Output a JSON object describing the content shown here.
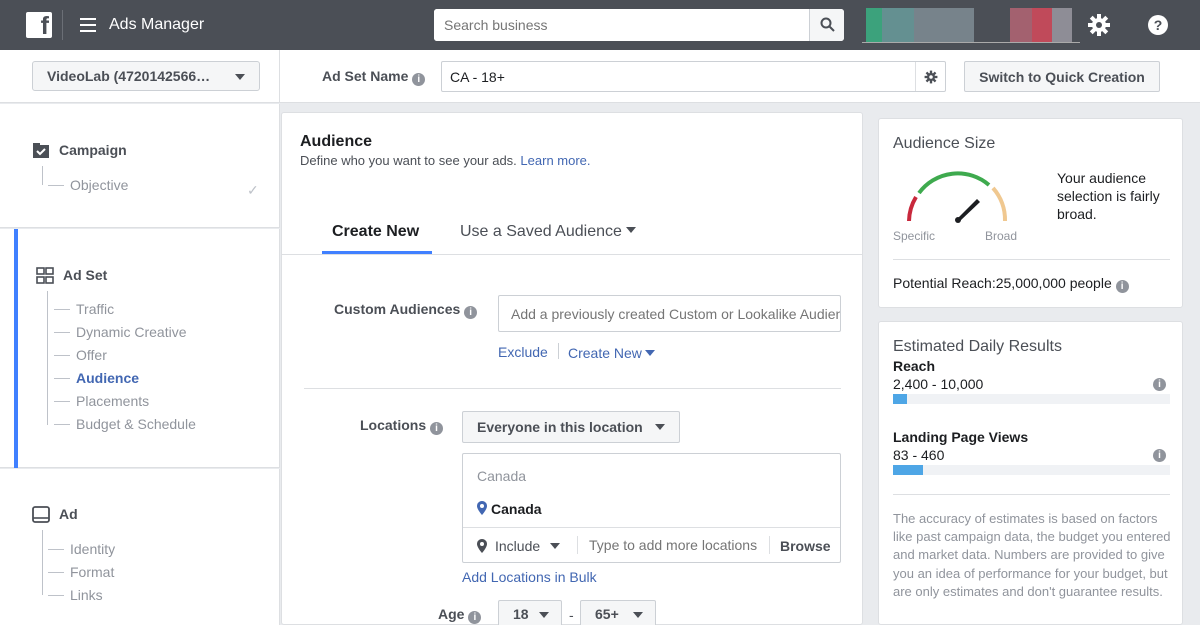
{
  "header": {
    "logo": "f",
    "app_title": "Ads Manager",
    "search_placeholder": "Search business",
    "icons": [
      "hamburger-icon",
      "search-icon",
      "gear-icon",
      "help-icon"
    ]
  },
  "account": {
    "selector_label": "VideoLab (4720142566…"
  },
  "adset_bar": {
    "label": "Ad Set Name",
    "value": "CA - 18+",
    "quick_creation_label": "Switch to Quick Creation"
  },
  "nav": {
    "campaign": {
      "label": "Campaign",
      "items": [
        {
          "label": "Objective"
        }
      ]
    },
    "adset": {
      "label": "Ad Set",
      "items": [
        {
          "label": "Traffic"
        },
        {
          "label": "Dynamic Creative"
        },
        {
          "label": "Offer"
        },
        {
          "label": "Audience"
        },
        {
          "label": "Placements"
        },
        {
          "label": "Budget & Schedule"
        }
      ]
    },
    "ad": {
      "label": "Ad",
      "items": [
        {
          "label": "Identity"
        },
        {
          "label": "Format"
        },
        {
          "label": "Links"
        }
      ]
    }
  },
  "audience": {
    "title": "Audience",
    "subtitle": "Define who you want to see your ads.",
    "learn_more": "Learn more.",
    "tabs": [
      {
        "label": "Create New"
      },
      {
        "label": "Use a Saved Audience"
      }
    ],
    "custom_audiences": {
      "label": "Custom Audiences",
      "placeholder": "Add a previously created Custom or Lookalike Audience",
      "exclude": "Exclude",
      "create_new": "Create New"
    },
    "locations": {
      "label": "Locations",
      "selector": "Everyone in this location",
      "country_heading": "Canada",
      "selected": "Canada",
      "include": "Include",
      "type_placeholder": "Type to add more locations",
      "browse": "Browse",
      "bulk_link": "Add Locations in Bulk"
    },
    "age": {
      "label": "Age",
      "min": "18",
      "dash": "-",
      "max": "65+"
    }
  },
  "audience_size": {
    "title": "Audience Size",
    "gauge_left": "Specific",
    "gauge_right": "Broad",
    "description": "Your audience selection is fairly broad.",
    "potential_reach": "Potential Reach:25,000,000 people"
  },
  "estimates": {
    "title": "Estimated Daily Results",
    "results": [
      {
        "label": "Reach",
        "value": "2,400 - 10,000",
        "fill": 0.05
      },
      {
        "label": "Landing Page Views",
        "value": "83 - 460",
        "fill": 0.11
      }
    ],
    "disclaimer": "The accuracy of estimates is based on factors like past campaign data, the budget you entered and market data. Numbers are provided to give you an idea of performance for your budget, but are only estimates and don't guarantee results."
  },
  "colors": {
    "topbar": "#4b4f56",
    "accent_blue": "#4267b2",
    "active_bar": "#4080ff",
    "progress": "#4ea6e6"
  }
}
